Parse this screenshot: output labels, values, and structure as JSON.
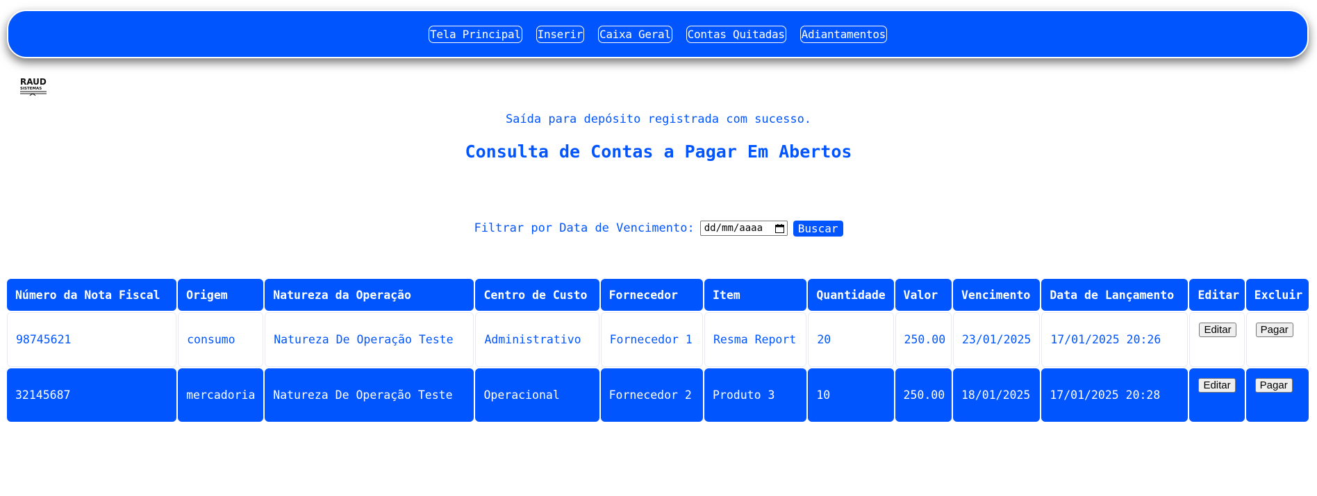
{
  "nav": {
    "items": [
      "Tela Principal",
      "Inserir",
      "Caixa Geral",
      "Contas Quitadas",
      "Adiantamentos"
    ]
  },
  "logo": {
    "text": "RAUD",
    "subtext": "SISTEMAS",
    "icon": "raud-logo"
  },
  "message": "Saída para depósito registrada com sucesso.",
  "page_title": "Consulta de Contas a Pagar Em Abertos",
  "filter": {
    "label": "Filtrar por Data de Vencimento:",
    "date_placeholder": "dd/mm/aaaa",
    "search_label": "Buscar"
  },
  "table": {
    "headers": [
      "Número da Nota Fiscal",
      "Origem",
      "Natureza da Operação",
      "Centro de Custo",
      "Fornecedor",
      "Item",
      "Quantidade",
      "Valor",
      "Vencimento",
      "Data de Lançamento",
      "Editar",
      "Excluir"
    ],
    "rows": [
      {
        "nota": "98745621",
        "origem": "consumo",
        "natureza": "Natureza De Operação Teste",
        "centro": "Administrativo",
        "fornecedor": "Fornecedor 1",
        "item": "Resma Report",
        "quantidade": "20",
        "valor": "250.00",
        "vencimento": "23/01/2025",
        "lancamento": "17/01/2025 20:26",
        "edit_label": "Editar",
        "pay_label": "Pagar"
      },
      {
        "nota": "32145687",
        "origem": "mercadoria",
        "natureza": "Natureza De Operação Teste",
        "centro": "Operacional",
        "fornecedor": "Fornecedor 2",
        "item": "Produto 3",
        "quantidade": "10",
        "valor": "250.00",
        "vencimento": "18/01/2025",
        "lancamento": "17/01/2025 20:28",
        "edit_label": "Editar",
        "pay_label": "Pagar"
      }
    ]
  },
  "colors": {
    "accent": "#0055ff",
    "background": "#ffffff"
  }
}
